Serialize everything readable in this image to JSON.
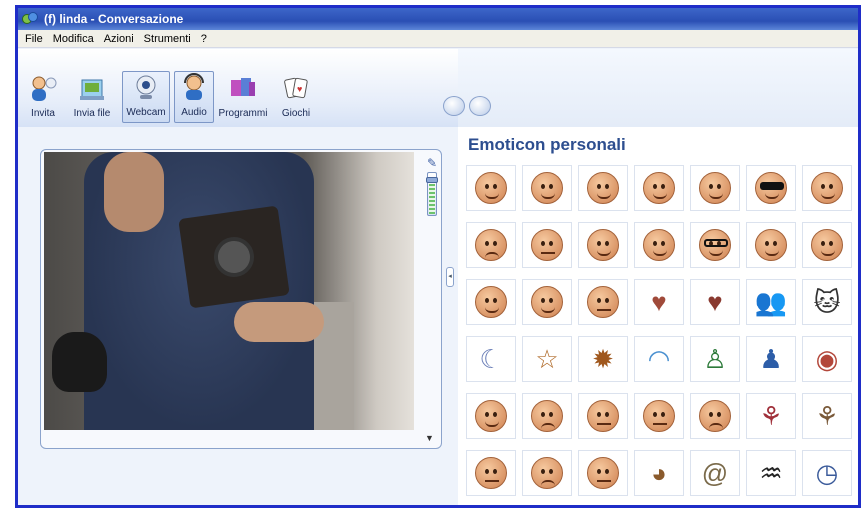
{
  "window": {
    "title": "(f) linda - Conversazione"
  },
  "menu": [
    "File",
    "Modifica",
    "Azioni",
    "Strumenti",
    "?"
  ],
  "toolbar": [
    {
      "label": "Invita",
      "icon": "invite-contacts-icon",
      "pressed": false
    },
    {
      "label": "Invia file",
      "icon": "send-file-icon",
      "pressed": false
    },
    {
      "label": "Webcam",
      "icon": "webcam-icon",
      "pressed": true
    },
    {
      "label": "Audio",
      "icon": "audio-headset-icon",
      "pressed": true
    },
    {
      "label": "Programmi",
      "icon": "programs-icon",
      "pressed": false
    },
    {
      "label": "Giochi",
      "icon": "games-icon",
      "pressed": false
    }
  ],
  "emoticons": {
    "title": "Emoticon personali",
    "rows": [
      [
        "smile-face",
        "grin-face",
        "wink-face",
        "surprised-face",
        "tongue-face",
        "sunglasses-face",
        "angry-face"
      ],
      [
        "crying-face",
        "confused-face",
        "embarrassed-face",
        "teeth-face",
        "nerd-face",
        "sick-face",
        "party-face"
      ],
      [
        "whisper-face",
        "devil-face",
        "eye-roll-face",
        "heart",
        "broken-heart",
        "friends",
        "cat"
      ],
      [
        "moon",
        "star",
        "sun",
        "rainbow",
        "boy-hug",
        "girl-hug",
        "lips"
      ],
      [
        "smile-face",
        "sad-face",
        "worried-face",
        "thinking-face",
        "frown-face",
        "rose",
        "wilted-rose"
      ],
      [
        "sleepy-face",
        "disappointed-face",
        "sarcastic-face",
        "dog",
        "snail",
        "sheep",
        "clock"
      ]
    ]
  }
}
